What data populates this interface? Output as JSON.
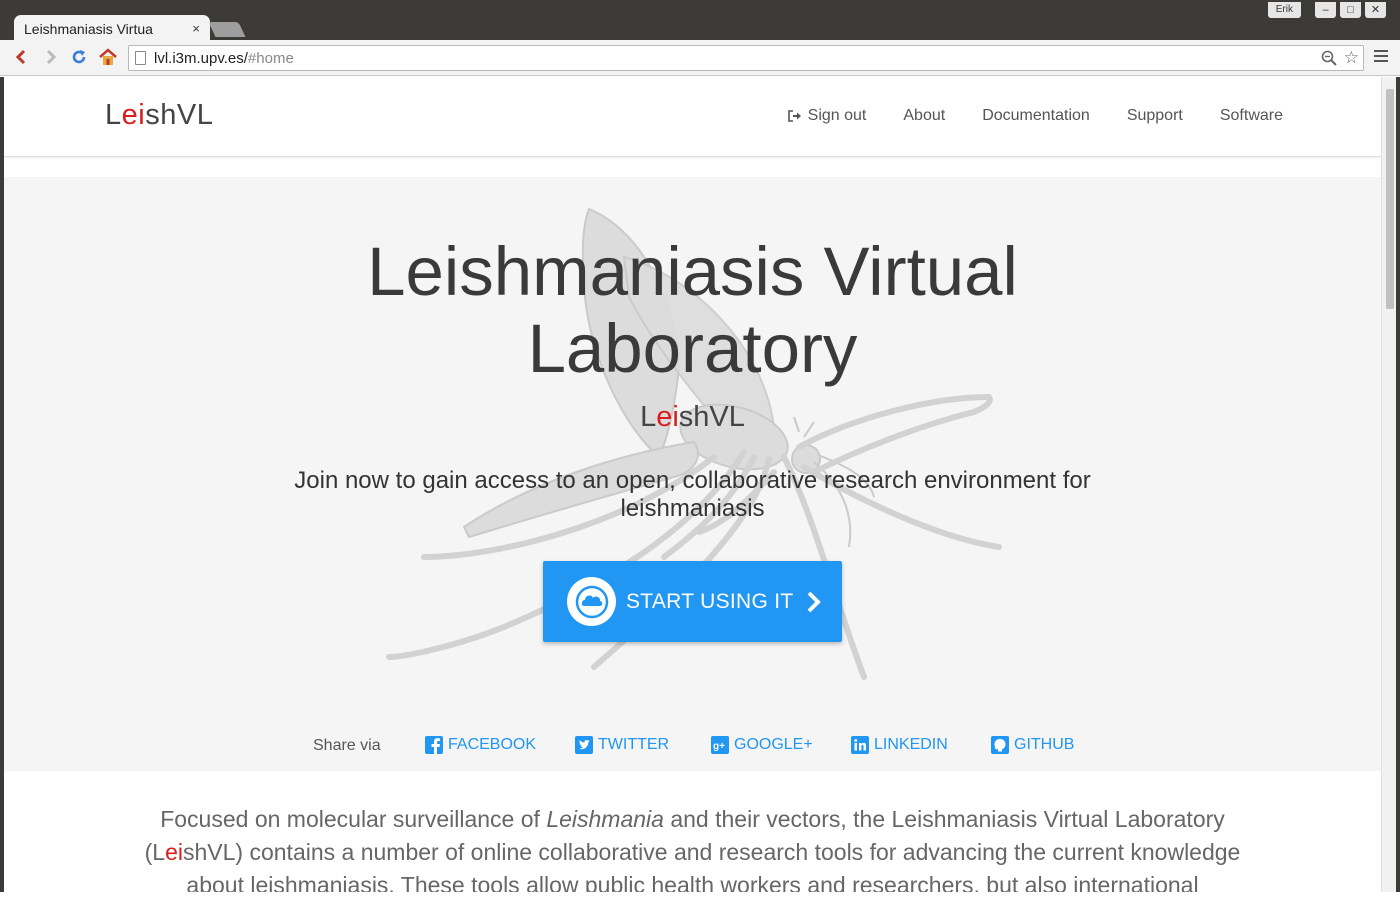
{
  "browser": {
    "tab_title": "Leishmaniasis Virtua",
    "tab_close": "×",
    "url_host": "lvl.i3m.upv.es/",
    "url_path": "#home",
    "user_badge": "Erik",
    "window_buttons": [
      "–",
      "□",
      "✕"
    ]
  },
  "navbar": {
    "brand_prefix": "L",
    "brand_red": "ei",
    "brand_suffix": "shVL",
    "links": [
      {
        "label": "Sign out",
        "icon": "sign-out-icon"
      },
      {
        "label": "About"
      },
      {
        "label": "Documentation"
      },
      {
        "label": "Support"
      },
      {
        "label": "Software"
      }
    ]
  },
  "hero": {
    "title_line1": "Leishmaniasis Virtual",
    "title_line2": "Laboratory",
    "sub_prefix": "L",
    "sub_red": "ei",
    "sub_suffix": "shVL",
    "tagline_line1": "Join now to gain access to an open, collaborative research environment for",
    "tagline_line2": "leishmaniasis",
    "cta_label": "START USING IT",
    "cta_icon": "cloud-icon",
    "background_image": "mosquito-illustration"
  },
  "share": {
    "label": "Share via",
    "items": [
      {
        "label": "FACEBOOK",
        "icon": "facebook-icon"
      },
      {
        "label": "TWITTER",
        "icon": "twitter-icon"
      },
      {
        "label": "GOOGLE+",
        "icon": "google-plus-icon"
      },
      {
        "label": "LINKEDIN",
        "icon": "linkedin-icon"
      },
      {
        "label": "GITHUB",
        "icon": "github-icon"
      }
    ]
  },
  "description": {
    "part1": "Focused on molecular surveillance of ",
    "italic": "Leishmania",
    "part2": " and their vectors, the Leishmaniasis Virtual Laboratory",
    "part3": "(L",
    "red": "ei",
    "part4": "shVL) contains a number of online collaborative and research tools for advancing the current knowledge",
    "part5": "about leishmaniasis. These tools allow public health workers and researchers, but also international"
  },
  "colors": {
    "accent": "#2196f3",
    "brand_red": "#d81e1e",
    "hero_bg": "#f5f5f5"
  }
}
